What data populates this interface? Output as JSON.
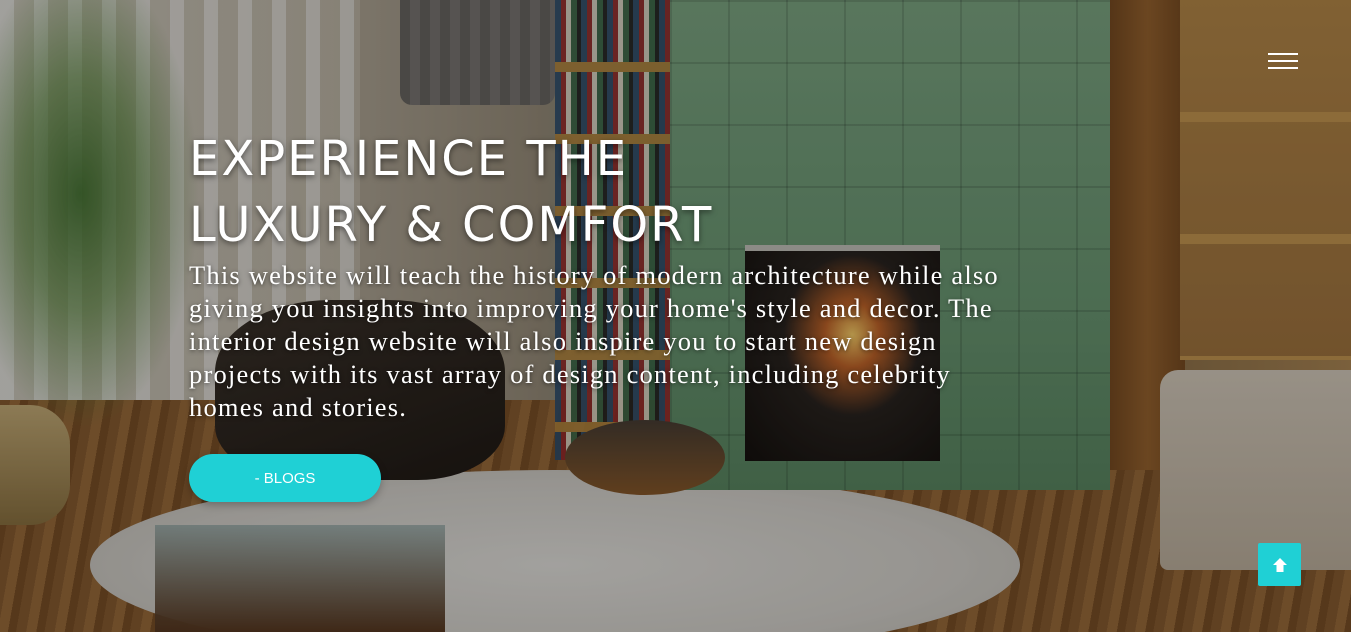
{
  "nav": {
    "menu_icon": "hamburger-menu-icon"
  },
  "hero": {
    "headline_line1": "EXPERIENCE THE",
    "headline_line2": "LUXURY & COMFORT",
    "description": "This website will teach the history of modern architecture while also giving you insights into improving your home's style and decor. The interior design website will also inspire you to start new design projects with its vast array of design content, including celebrity homes and stories.",
    "button_label": "- BLOGS"
  },
  "scroll_top": {
    "icon": "arrow-up-icon"
  },
  "colors": {
    "accent": "#1fd0d5",
    "text": "#ffffff"
  }
}
